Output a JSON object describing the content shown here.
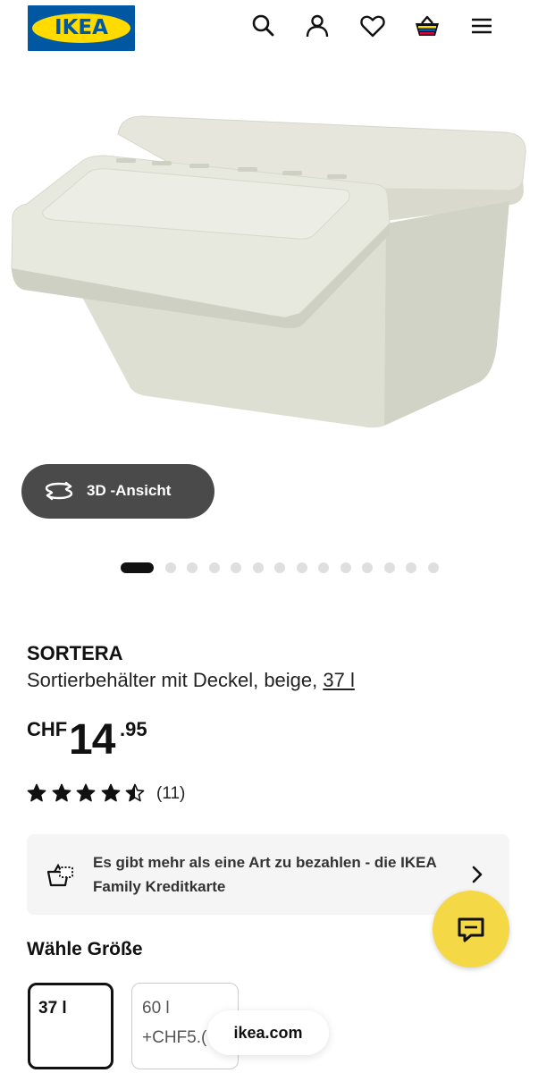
{
  "header": {
    "logo_text": "IKEA",
    "icons": [
      "search-icon",
      "account-icon",
      "wishlist-icon",
      "cart-icon",
      "menu-icon"
    ]
  },
  "gallery": {
    "view_3d_label": "3D -Ansicht",
    "total_images": 14,
    "active_index": 0
  },
  "product": {
    "name": "SORTERA",
    "description": "Sortierbehälter mit Deckel, beige,",
    "volume_link": "37 l",
    "price": {
      "currency": "CHF",
      "integer": "14",
      "decimals": ".95"
    },
    "rating": {
      "stars": 4.5,
      "max": 5,
      "count": "(11)"
    }
  },
  "payment_banner": {
    "text": "Es gibt mehr als eine Art zu bezahlen - die IKEA Family Kreditkarte"
  },
  "size_selector": {
    "title": "Wähle Größe",
    "options": [
      {
        "label": "37 l",
        "selected": true
      },
      {
        "label": "60 l",
        "price_diff": "+CHF5.(",
        "selected": false
      }
    ]
  },
  "browser": {
    "domain": "ikea.com"
  },
  "colors": {
    "ikea_blue": "#0058a3",
    "ikea_yellow": "#ffdb00",
    "chat_yellow": "#f5d845",
    "button_dark": "#4a4a4a"
  }
}
